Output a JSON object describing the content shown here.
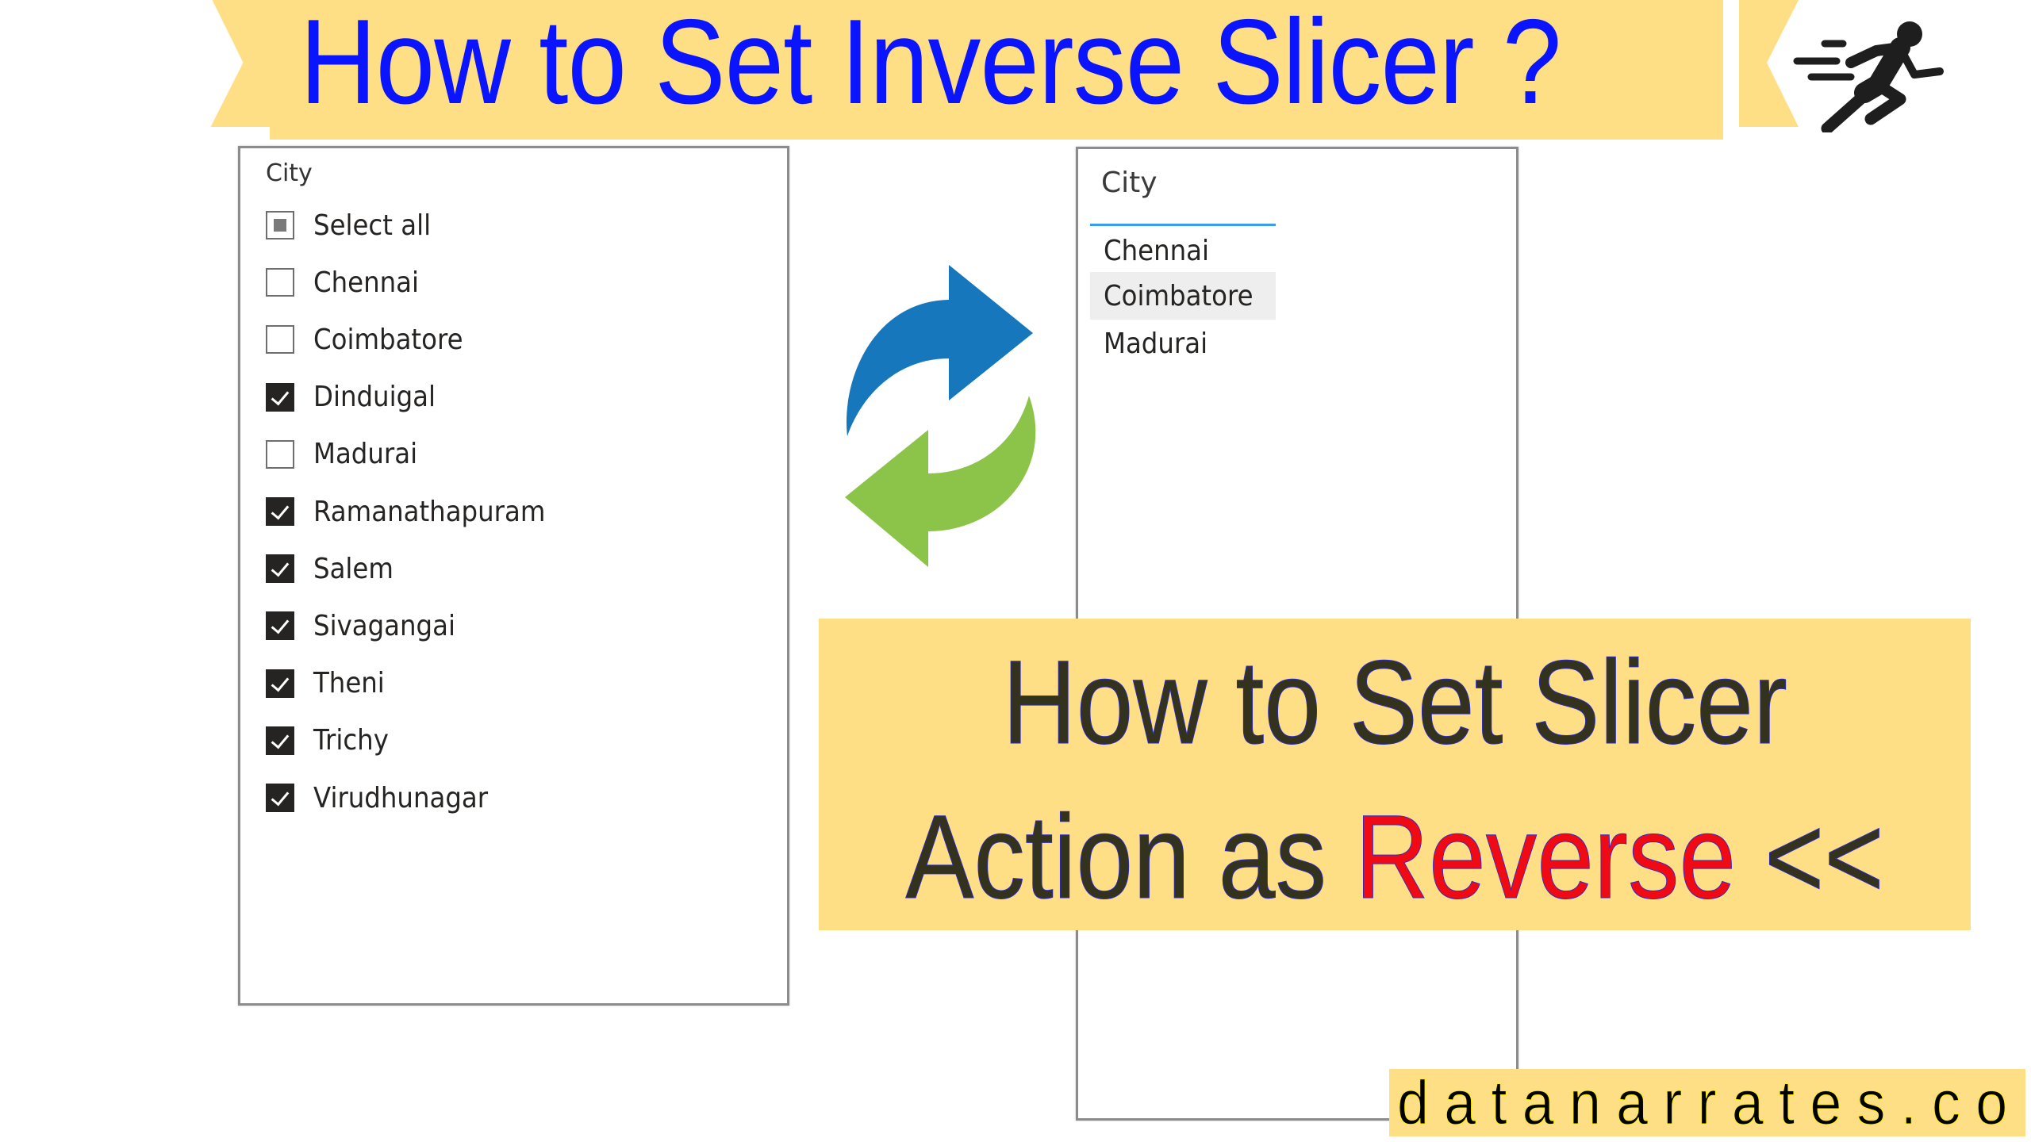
{
  "header": {
    "title": "How to Set Inverse Slicer ?",
    "title_color": "#0A14FF",
    "ribbon_color": "#FFDF85",
    "icon": "running-person-icon"
  },
  "left_slicer": {
    "title": "City",
    "items": [
      {
        "label": "Select all",
        "state": "partial"
      },
      {
        "label": "Chennai",
        "state": "unchecked"
      },
      {
        "label": "Coimbatore",
        "state": "unchecked"
      },
      {
        "label": "Dinduigal",
        "state": "checked"
      },
      {
        "label": "Madurai",
        "state": "unchecked"
      },
      {
        "label": "Ramanathapuram",
        "state": "checked"
      },
      {
        "label": "Salem",
        "state": "checked"
      },
      {
        "label": "Sivagangai",
        "state": "checked"
      },
      {
        "label": "Theni",
        "state": "checked"
      },
      {
        "label": "Trichy",
        "state": "checked"
      },
      {
        "label": "Virudhunagar",
        "state": "checked"
      }
    ]
  },
  "center_icon": {
    "name": "swap-arrows-icon",
    "colors": {
      "forward": "#1777BC",
      "back": "#8CC449"
    }
  },
  "right_slicer": {
    "title": "City",
    "underline_color": "#3B9BEF",
    "items": [
      {
        "label": "Chennai",
        "highlighted": false
      },
      {
        "label": "Coimbatore",
        "highlighted": true
      },
      {
        "label": "Madurai",
        "highlighted": false
      }
    ]
  },
  "banner": {
    "line1": "How to Set Slicer",
    "line2_prefix": "Action as ",
    "line2_highlight": "Reverse",
    "line2_suffix": " <<",
    "text_color": "#33321C",
    "highlight_color": "#F00A14"
  },
  "watermark": {
    "text": "datanarrates.com"
  }
}
